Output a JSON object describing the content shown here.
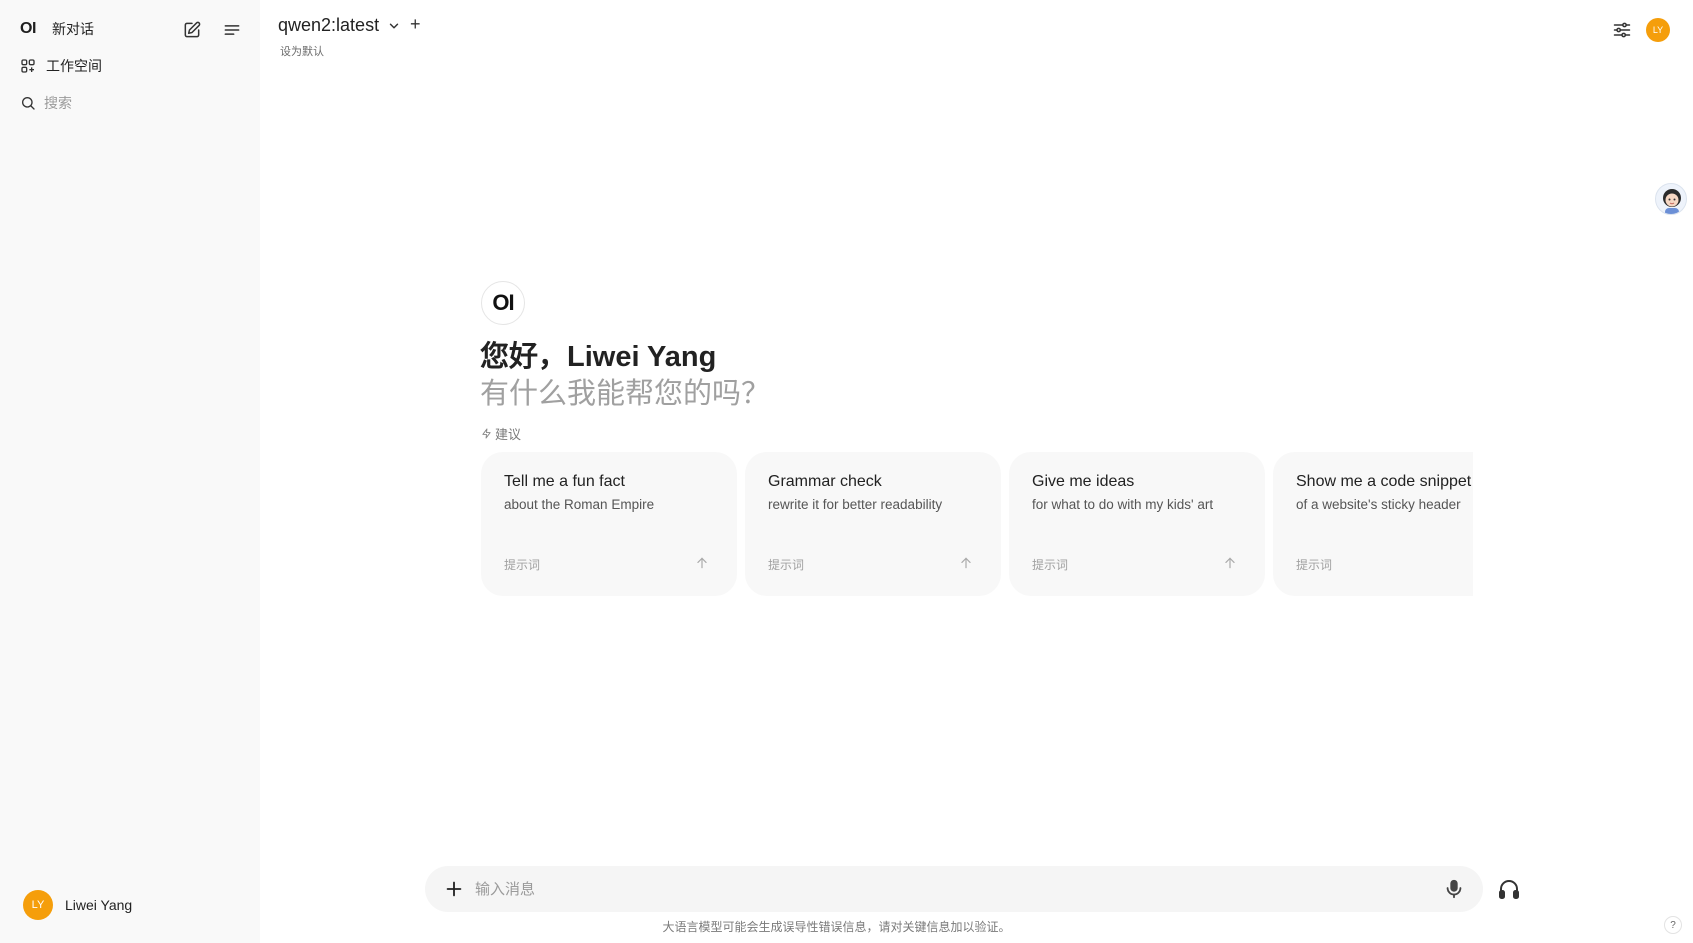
{
  "sidebar": {
    "logo": "OI",
    "new_chat_label": "新对话",
    "workspace_label": "工作空间",
    "search_placeholder": "搜索",
    "user": {
      "initials": "LY",
      "name": "Liwei Yang"
    }
  },
  "header": {
    "model_name": "qwen2:latest",
    "add_model": "+",
    "set_default": "设为默认",
    "avatar_initials": "LY"
  },
  "welcome": {
    "logo": "OI",
    "greeting": "您好，Liwei Yang",
    "subgreeting": "有什么我能帮您的吗？",
    "suggestions_label": "建议"
  },
  "suggestions": [
    {
      "title": "Tell me a fun fact",
      "subtitle": "about the Roman Empire",
      "tag": "提示词"
    },
    {
      "title": "Grammar check",
      "subtitle": "rewrite it for better readability",
      "tag": "提示词"
    },
    {
      "title": "Give me ideas",
      "subtitle": "for what to do with my kids' art",
      "tag": "提示词"
    },
    {
      "title": "Show me a code snippet",
      "subtitle": "of a website's sticky header",
      "tag": "提示词"
    }
  ],
  "composer": {
    "placeholder": "输入消息",
    "disclaimer": "大语言模型可能会生成误导性错误信息，请对关键信息加以验证。",
    "help": "?"
  },
  "colors": {
    "avatar_accent": "#f59e0b"
  },
  "icons": [
    "new-chat-icon",
    "menu-icon",
    "workspace-icon",
    "search-icon",
    "chevron-down-icon",
    "controls-icon",
    "lightning-icon",
    "arrow-up-icon",
    "plus-icon",
    "microphone-icon",
    "headset-icon"
  ]
}
